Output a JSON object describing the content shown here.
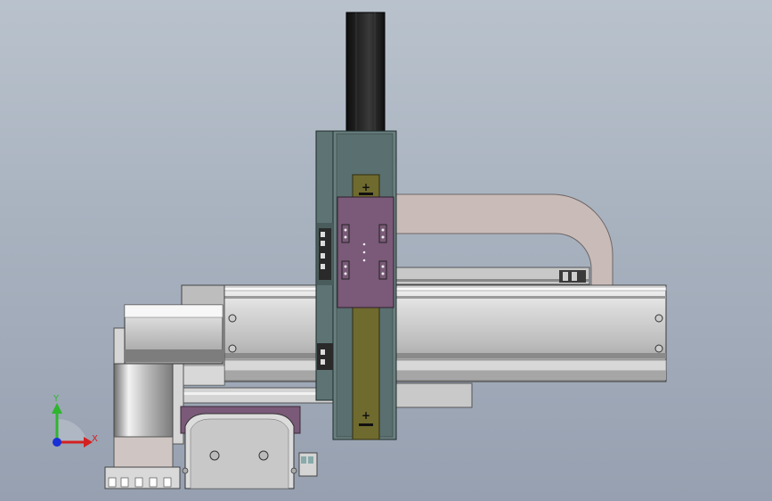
{
  "viewport": {
    "background_top": "#b9c2cc",
    "background_bottom": "#96a0b0"
  },
  "triad": {
    "x_label": "X",
    "y_label": "Y",
    "x_color": "#d42020",
    "y_color": "#2fb52f",
    "z_color": "#1a2fd6"
  },
  "model": {
    "carriage_color": "#7a5a78",
    "frame_color": "#5e7474",
    "rail_color": "#6f6a2e",
    "cable_color": "#c9bcb8",
    "motor_color": "#1c1c1c"
  }
}
